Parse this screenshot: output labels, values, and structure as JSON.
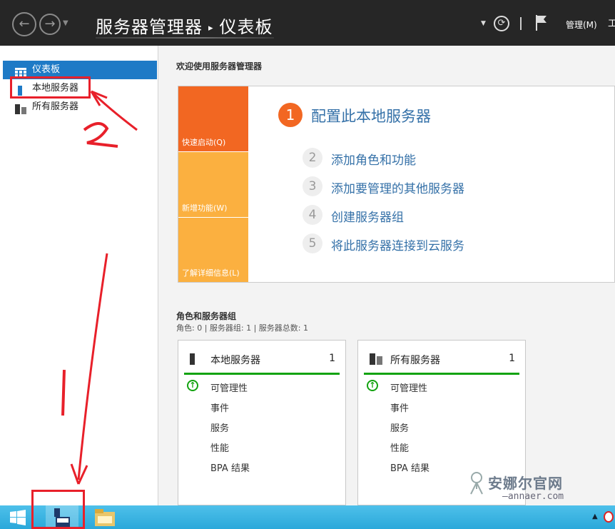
{
  "titlebar": {
    "breadcrumb_app": "服务器管理器",
    "breadcrumb_separator": "▸",
    "breadcrumb_page": "仪表板",
    "manage_menu": "管理(M)"
  },
  "sidebar": {
    "items": [
      {
        "label": "仪表板"
      },
      {
        "label": "本地服务器"
      },
      {
        "label": "所有服务器"
      }
    ]
  },
  "main": {
    "welcome_title": "欢迎使用服务器管理器",
    "quick_tiles": [
      {
        "label": "快速启动(Q)",
        "color": "#f26722"
      },
      {
        "label": "新增功能(W)",
        "color": "#fbb040"
      },
      {
        "label": "了解详细信息(L)",
        "color": "#fbb040"
      }
    ],
    "steps": [
      {
        "num": "1",
        "label": "配置此本地服务器"
      },
      {
        "num": "2",
        "label": "添加角色和功能"
      },
      {
        "num": "3",
        "label": "添加要管理的其他服务器"
      },
      {
        "num": "4",
        "label": "创建服务器组"
      },
      {
        "num": "5",
        "label": "将此服务器连接到云服务"
      }
    ],
    "roles_title": "角色和服务器组",
    "roles_subtitle": "角色: 0 | 服务器组: 1 | 服务器总数: 1",
    "cards": [
      {
        "title": "本地服务器",
        "count": "1",
        "rows": [
          "可管理性",
          "事件",
          "服务",
          "性能",
          "BPA 结果"
        ]
      },
      {
        "title": "所有服务器",
        "count": "1",
        "rows": [
          "可管理性",
          "事件",
          "服务",
          "性能",
          "BPA 结果"
        ]
      }
    ]
  },
  "watermark": {
    "line1": "安娜尔官网",
    "line2": "—annaer.com"
  },
  "annotations": {
    "mark1": "1",
    "mark2": "2"
  },
  "colors": {
    "accent": "#1e7ac6",
    "orange": "#f26722",
    "light_orange": "#fbb040",
    "ok_green": "#13a310",
    "highlight_red": "#e8202a"
  }
}
